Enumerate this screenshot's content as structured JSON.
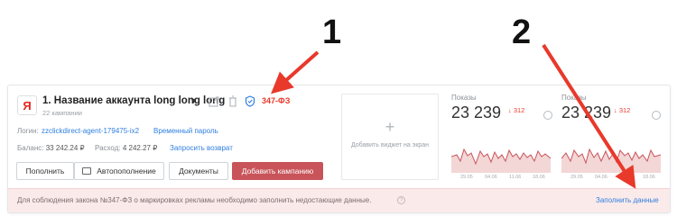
{
  "account": {
    "logo_letter": "Я",
    "title": "1. Название аккаунта long long long",
    "campaigns": "22 кампании",
    "law_badge": "347-ФЗ",
    "login_label": "Логин:",
    "login_value": "zzclickdirect-agent-179475-ix2",
    "temp_password": "Временный пароль",
    "balance_label": "Баланс:",
    "balance_value": "33 242.24 ₽",
    "expense_label": "Расход:",
    "expense_value": "4 242.27 ₽",
    "refund_link": "Запросить возврат"
  },
  "buttons": {
    "topup": "Пополнить",
    "autotopup": "Автопополнение",
    "documents": "Документы",
    "add_campaign": "Добавить кампанию"
  },
  "widget": {
    "plus": "+",
    "text": "Добавить виджет на экран"
  },
  "stats": [
    {
      "label": "Показы",
      "value": "23 239",
      "delta": "↓ 312",
      "ticks": [
        "29.05",
        "04.06",
        "11.06",
        "18.06"
      ]
    },
    {
      "label": "Показы",
      "value": "23 239",
      "delta": "↓ 312",
      "ticks": [
        "29.05",
        "04.06",
        "11.06",
        "18.06"
      ]
    }
  ],
  "banner": {
    "text": "Для соблюдения закона №347-ФЗ о маркировках рекламы необходимо заполнить недостающие данные.",
    "info": "?",
    "link": "Заполнить данные"
  },
  "callouts": [
    "1",
    "2"
  ],
  "colors": {
    "accent_red": "#e8392b",
    "link_blue": "#2f7fe0",
    "primary_button": "#c8545a",
    "banner_bg": "#fbeaea"
  }
}
